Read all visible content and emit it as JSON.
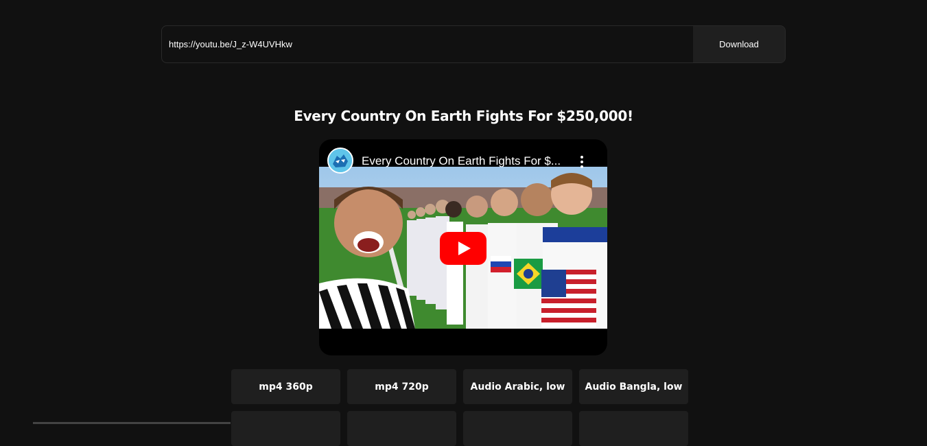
{
  "url_bar": {
    "value": "https://youtu.be/J_z-W4UVHkw",
    "download_label": "Download"
  },
  "video": {
    "title": "Every Country On Earth Fights For $250,000!",
    "player_title": "Every Country On Earth Fights For $...",
    "channel_avatar_icon": "channel-avatar-icon",
    "more_icon": "more-vert-icon",
    "play_icon": "youtube-play-icon"
  },
  "formats": [
    {
      "label": "mp4 360p"
    },
    {
      "label": "mp4 720p"
    },
    {
      "label": "Audio Arabic, low"
    },
    {
      "label": "Audio Bangla, low"
    },
    {
      "label": ""
    },
    {
      "label": ""
    },
    {
      "label": ""
    },
    {
      "label": ""
    }
  ],
  "colors": {
    "background": "#111111",
    "button_bg": "#1f1f1f",
    "play_red": "#ff0000"
  }
}
